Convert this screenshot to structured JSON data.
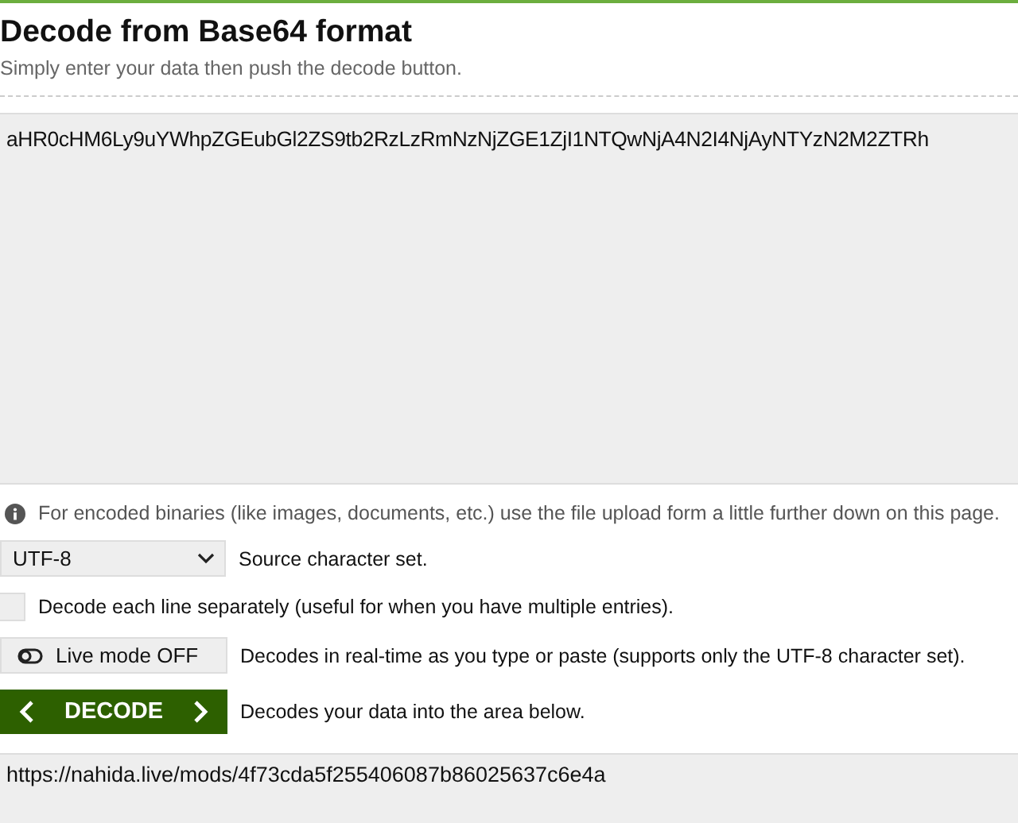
{
  "title": "Decode from Base64 format",
  "subtitle": "Simply enter your data then push the decode button.",
  "input": {
    "value": "aHR0cHM6Ly9uYWhpZGEubGl2ZS9tb2RzLzRmNzNjZGE1ZjI1NTQwNjA4N2I4NjAyNTYzN2M2ZTRh"
  },
  "info": "For encoded binaries (like images, documents, etc.) use the file upload form a little further down on this page.",
  "charset": {
    "value": "UTF-8",
    "label": "Source character set."
  },
  "each_line": {
    "checked": false,
    "label": "Decode each line separately (useful for when you have multiple entries)."
  },
  "live_mode": {
    "on": false,
    "button": "Live mode OFF",
    "label": "Decodes in real-time as you type or paste (supports only the UTF-8 character set)."
  },
  "decode": {
    "button": "DECODE",
    "label": "Decodes your data into the area below."
  },
  "output": {
    "value": "https://nahida.live/mods/4f73cda5f255406087b86025637c6e4a"
  }
}
